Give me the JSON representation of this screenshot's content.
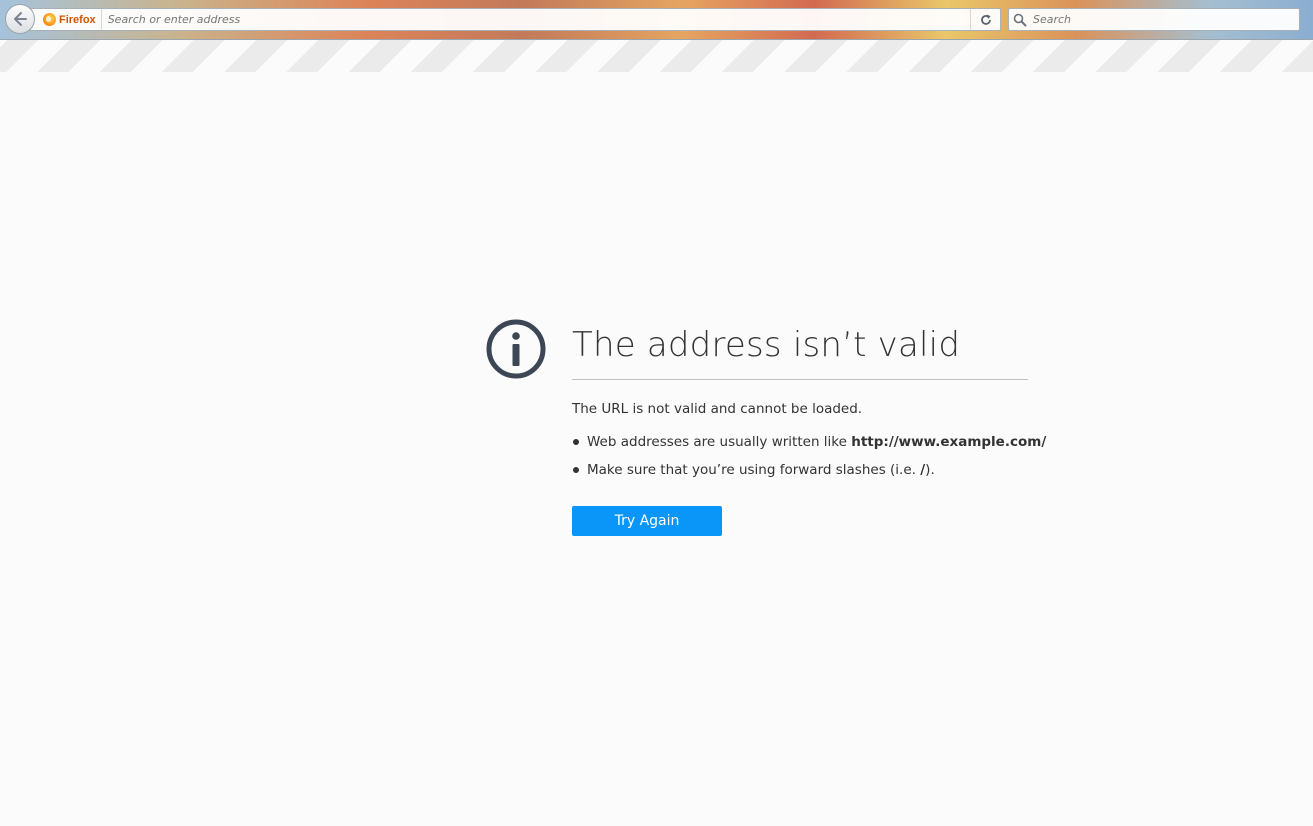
{
  "browser": {
    "identity_label": "Firefox",
    "url_placeholder": "Search or enter address",
    "search_placeholder": "Search",
    "icons": {
      "back": "back-arrow-icon",
      "identity": "firefox-logo-icon",
      "reload": "reload-icon",
      "search": "search-icon"
    }
  },
  "error_page": {
    "icon": "info-icon",
    "title": "The address isn’t valid",
    "short_desc": "The URL is not valid and cannot be loaded.",
    "bullets": [
      {
        "prefix": "Web addresses are usually written like ",
        "strong": "http://www.example.com/",
        "suffix": ""
      },
      {
        "prefix": "Make sure that you’re using forward slashes (i.e. ",
        "strong": "/",
        "suffix": ")."
      }
    ],
    "try_again_label": "Try Again"
  },
  "colors": {
    "button": "#0996f8",
    "text": "#333333",
    "icon": "#3c4654",
    "page_bg": "#fbfbfb"
  }
}
